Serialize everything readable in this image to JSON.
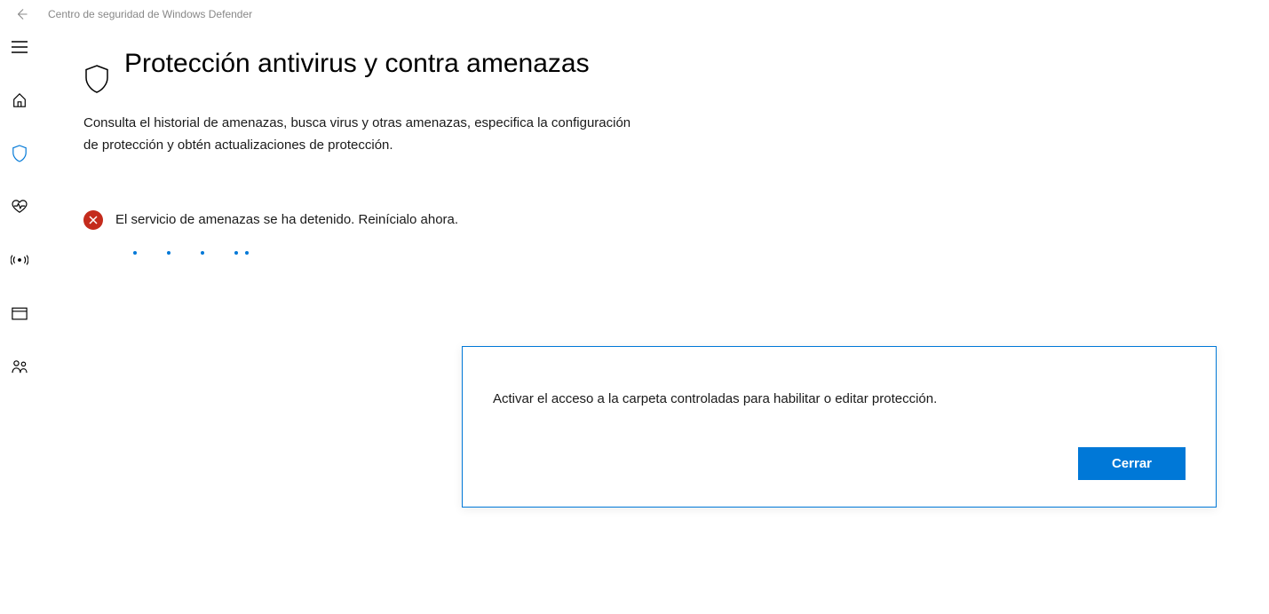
{
  "titlebar": {
    "app_title": "Centro de seguridad de Windows Defender"
  },
  "sidebar": {
    "items": [
      {
        "name": "menu-icon"
      },
      {
        "name": "home-icon"
      },
      {
        "name": "shield-icon",
        "active": true
      },
      {
        "name": "heart-icon"
      },
      {
        "name": "antenna-icon"
      },
      {
        "name": "browser-icon"
      },
      {
        "name": "family-icon"
      }
    ]
  },
  "page": {
    "title": "Protección antivirus y contra amenazas",
    "subtitle": "Consulta el historial de amenazas, busca virus y otras amenazas, especifica la configuración de protección y obtén actualizaciones de protección."
  },
  "status": {
    "message": "El servicio de amenazas se ha detenido. Reinícialo ahora.",
    "severity": "error"
  },
  "dialog": {
    "message": "Activar el acceso a la carpeta controladas para habilitar o editar protección.",
    "close_label": "Cerrar"
  },
  "colors": {
    "accent": "#0078d7",
    "error": "#c42b1c"
  }
}
